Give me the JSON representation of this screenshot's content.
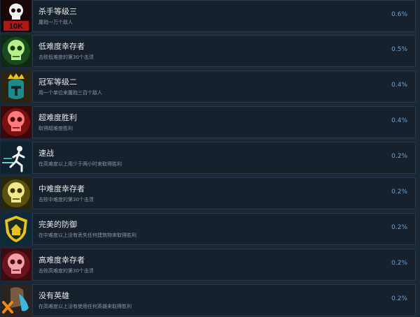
{
  "achievements": [
    {
      "title": "杀手等级三",
      "description": "屠戮一万个敌人",
      "percent": "0.6%",
      "icon": "skull-10k-icon",
      "icon_label": "10K"
    },
    {
      "title": "低难度幸存者",
      "description": "击败低难度的第30个击溃",
      "percent": "0.5%",
      "icon": "green-skull-icon"
    },
    {
      "title": "冠军等级二",
      "description": "用一个单位来屠戮三百个敌人",
      "percent": "0.4%",
      "icon": "crowned-helmet-icon"
    },
    {
      "title": "超难度胜利",
      "description": "取得超难度胜利",
      "percent": "0.4%",
      "icon": "red-skull-icon"
    },
    {
      "title": "速战",
      "description": "在高难度以上用少于两小时来取得胜利",
      "percent": "0.2%",
      "icon": "running-man-icon"
    },
    {
      "title": "中难度幸存者",
      "description": "击败中难度的第30个击溃",
      "percent": "0.2%",
      "icon": "yellow-skull-icon"
    },
    {
      "title": "完美的防御",
      "description": "在中难度以上没有丢失任何建筑物来取得胜利",
      "percent": "0.2%",
      "icon": "shield-house-icon"
    },
    {
      "title": "高难度幸存者",
      "description": "击败高难度的第30个击溃",
      "percent": "0.2%",
      "icon": "pink-skull-icon"
    },
    {
      "title": "没有英雄",
      "description": "在高难度以上没有使用任何英雄来取得胜利",
      "percent": "0.2%",
      "icon": "no-hero-icon"
    }
  ],
  "colors": {
    "background": "#1b2838",
    "panel": "#17212e",
    "percent": "#6aa3d9"
  }
}
